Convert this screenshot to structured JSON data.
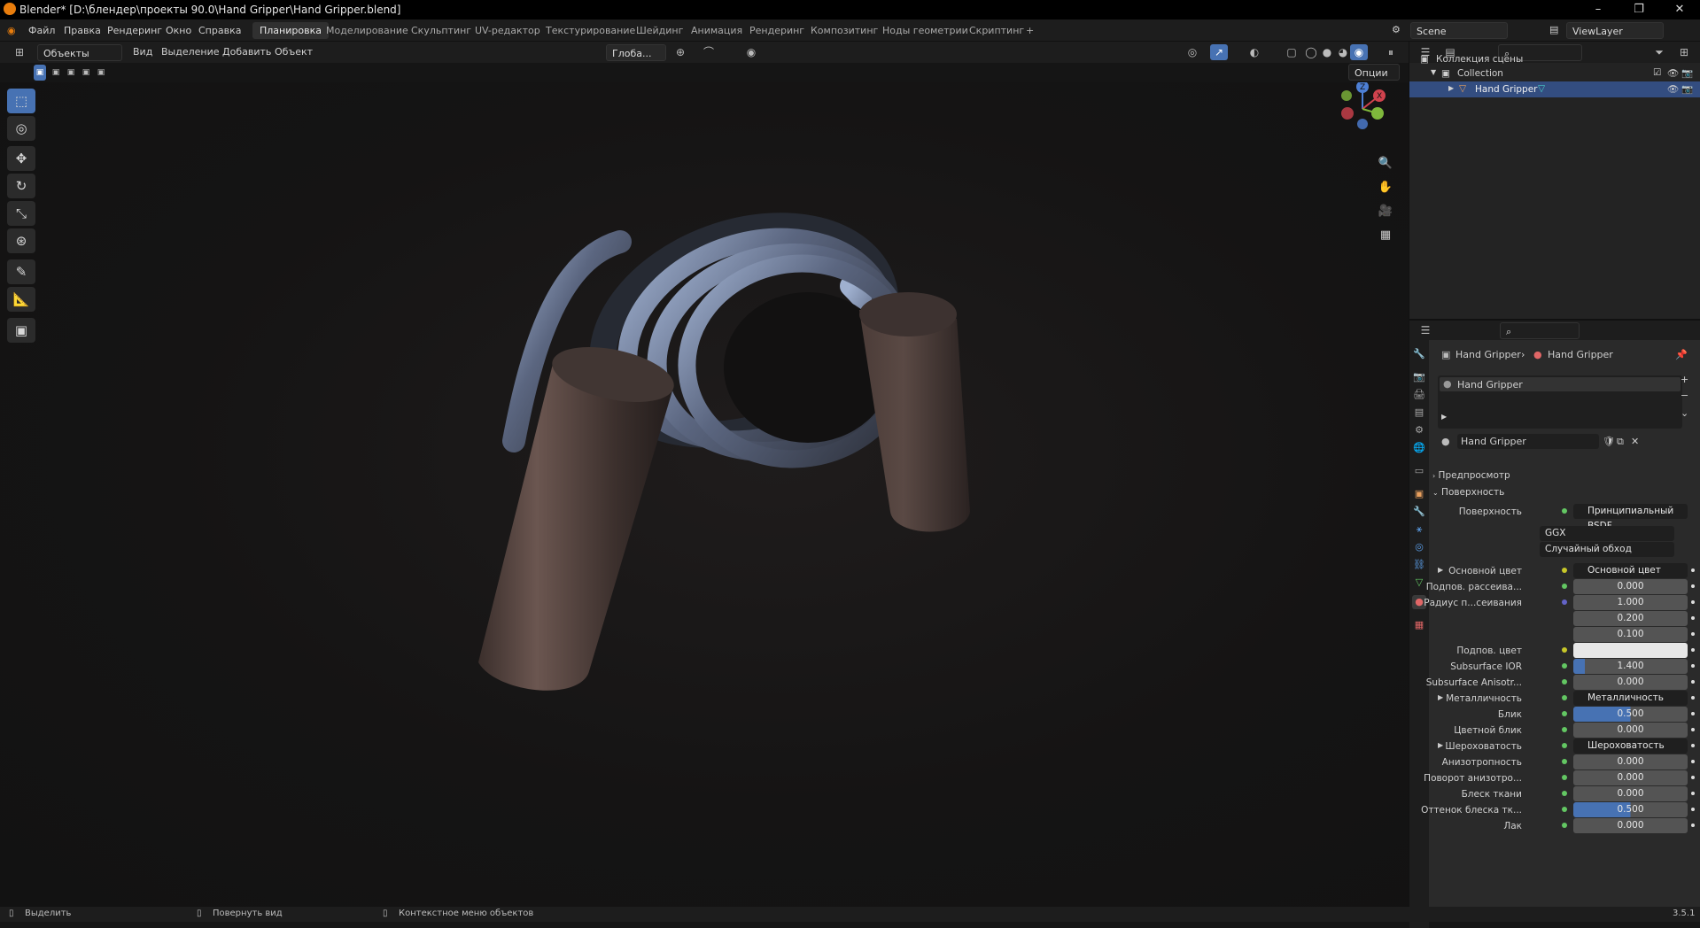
{
  "window": {
    "title": "Blender* [D:\\блендер\\проекты 90.0\\Hand Gripper\\Hand Gripper.blend]",
    "minimize": "–",
    "maximize": "❐",
    "close": "✕"
  },
  "menu": {
    "items": [
      "Файл",
      "Правка",
      "Рендеринг",
      "Окно",
      "Справка"
    ],
    "workspaces": [
      "Планировка",
      "Моделирование",
      "Скульптинг",
      "UV-редактор",
      "Текстурирование",
      "Шейдинг",
      "Анимация",
      "Рендеринг",
      "Композитинг",
      "Ноды геометрии",
      "Скриптинг"
    ],
    "add_tab": "+",
    "scene": "Scene",
    "view_layer": "ViewLayer"
  },
  "viewport_header": {
    "mode": "Объекты",
    "menus": [
      "Вид",
      "Выделение",
      "Добавить",
      "Объект"
    ],
    "transform_orientation": "Глоба...",
    "options": "Опции"
  },
  "gizmo": {
    "x": "X",
    "y": "Y",
    "z": "Z"
  },
  "outliner": {
    "scene_collection": "Коллекция сцены",
    "collection": "Collection",
    "object": "Hand Gripper"
  },
  "properties": {
    "breadcrumb_object": "Hand Gripper",
    "breadcrumb_material": "Hand Gripper",
    "slot": "Hand Gripper",
    "material_name": "Hand Gripper",
    "preview": "Предпросмотр",
    "surface_panel": "Поверхность",
    "surface_label": "Поверхность",
    "surface_value": "Принципиальный BSDF",
    "distribution": "GGX",
    "subsurface_method": "Случайный обход",
    "rows": [
      {
        "label": "Основной цвет",
        "value": "Основной цвет",
        "kind": "link",
        "dot": "y",
        "expand": true
      },
      {
        "label": "Подпов. рассеива...",
        "value": "0.000",
        "kind": "num",
        "dot": "g"
      },
      {
        "label": "Радиус п...сеивания",
        "value": "1.000",
        "kind": "num",
        "dot": "p"
      },
      {
        "label": "",
        "value": "0.200",
        "kind": "num",
        "dot": ""
      },
      {
        "label": "",
        "value": "0.100",
        "kind": "num",
        "dot": ""
      },
      {
        "label": "Подпов. цвет",
        "value": "",
        "kind": "color",
        "dot": "y"
      },
      {
        "label": "Subsurface IOR",
        "value": "1.400",
        "kind": "fill",
        "fill": 0.1,
        "dot": "g"
      },
      {
        "label": "Subsurface Anisotr...",
        "value": "0.000",
        "kind": "num",
        "dot": "g"
      },
      {
        "label": "Металличность",
        "value": "Металличность",
        "kind": "link",
        "dot": "g",
        "expand": true
      },
      {
        "label": "Блик",
        "value": "0.500",
        "kind": "fill",
        "fill": 0.5,
        "dot": "g"
      },
      {
        "label": "Цветной блик",
        "value": "0.000",
        "kind": "num",
        "dot": "g"
      },
      {
        "label": "Шероховатость",
        "value": "Шероховатость",
        "kind": "link",
        "dot": "g",
        "expand": true
      },
      {
        "label": "Анизотропность",
        "value": "0.000",
        "kind": "num",
        "dot": "g"
      },
      {
        "label": "Поворот анизотро...",
        "value": "0.000",
        "kind": "num",
        "dot": "g"
      },
      {
        "label": "Блеск ткани",
        "value": "0.000",
        "kind": "num",
        "dot": "g"
      },
      {
        "label": "Оттенок блеска тк...",
        "value": "0.500",
        "kind": "fill",
        "fill": 0.5,
        "dot": "g"
      },
      {
        "label": "Лак",
        "value": "0.000",
        "kind": "num",
        "dot": "g"
      }
    ]
  },
  "status": {
    "select": "Выделить",
    "rotate": "Повернуть вид",
    "context": "Контекстное меню объектов",
    "version": "3.5.1"
  }
}
